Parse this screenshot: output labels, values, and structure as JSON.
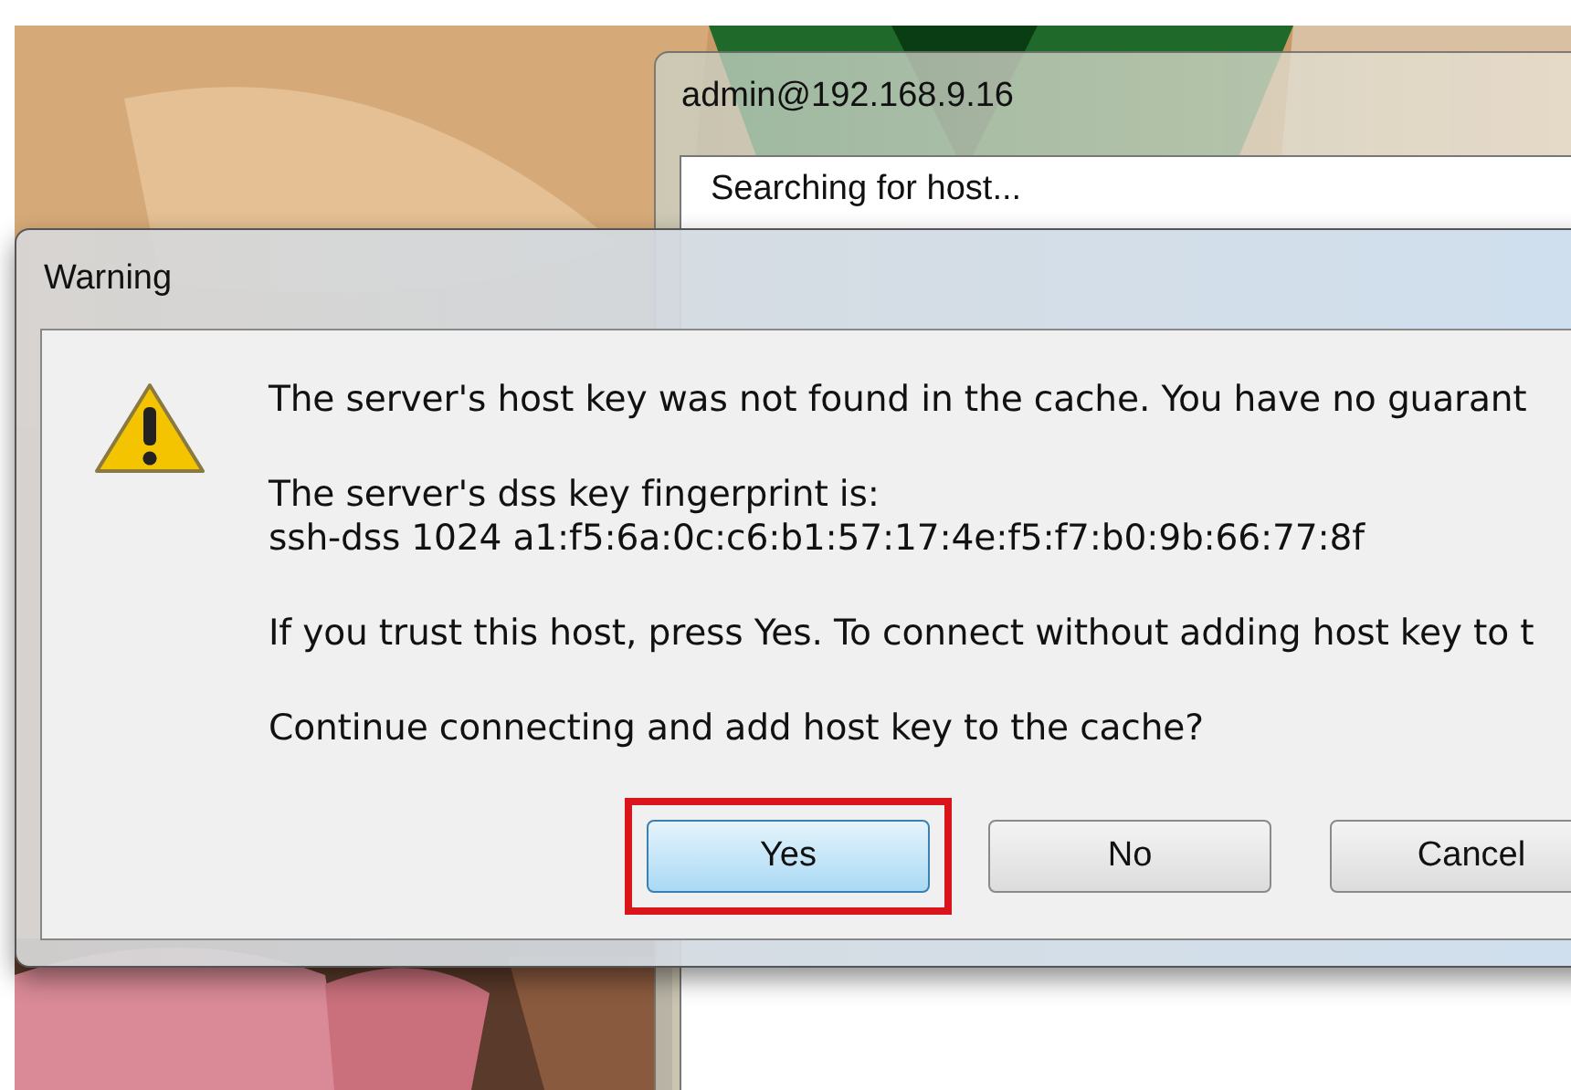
{
  "terminal_window": {
    "title": "admin@192.168.9.16",
    "status": "Searching for host..."
  },
  "dialog": {
    "title": "Warning",
    "paragraphs": [
      {
        "lines": [
          "The server's host key was not found in the cache. You have no guarant"
        ]
      },
      {
        "lines": [
          "The server's dss key fingerprint is:",
          "ssh-dss 1024 a1:f5:6a:0c:c6:b1:57:17:4e:f5:f7:b0:9b:66:77:8f"
        ]
      },
      {
        "lines": [
          "If you trust this host, press Yes. To connect without adding host key to t"
        ]
      },
      {
        "lines": [
          "Continue connecting and add host key to the cache?"
        ]
      }
    ],
    "buttons": [
      {
        "label": "Yes",
        "default": true,
        "highlighted": true
      },
      {
        "label": "No",
        "default": false,
        "highlighted": false
      },
      {
        "label": "Cancel",
        "default": false,
        "highlighted": false
      }
    ]
  }
}
